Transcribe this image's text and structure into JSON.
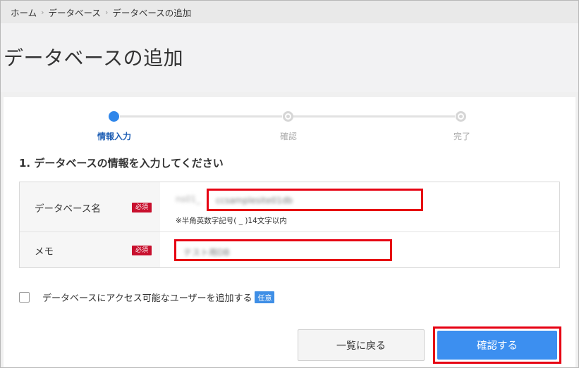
{
  "breadcrumb": {
    "items": [
      "ホーム",
      "データベース",
      "データベースの追加"
    ],
    "separator": "›"
  },
  "page": {
    "title": "データベースの追加"
  },
  "stepper": {
    "steps": [
      {
        "label": "情報入力",
        "state": "active"
      },
      {
        "label": "確認",
        "state": "inactive"
      },
      {
        "label": "完了",
        "state": "inactive"
      }
    ]
  },
  "form": {
    "section_heading": "1. データベースの情報を入力してください",
    "database_name": {
      "label": "データベース名",
      "required_badge": "必須",
      "hint": "※半角英数字記号( _ )14文字以内"
    },
    "memo": {
      "label": "メモ",
      "required_badge": "必須"
    }
  },
  "options": {
    "add_user_label": "データベースにアクセス可能なユーザーを追加する",
    "optional_badge": "任意"
  },
  "actions": {
    "back_label": "一覧に戻る",
    "confirm_label": "確認する"
  },
  "colors": {
    "accent": "#3c8ff0",
    "required": "#c8102e",
    "highlight": "#e60012"
  }
}
